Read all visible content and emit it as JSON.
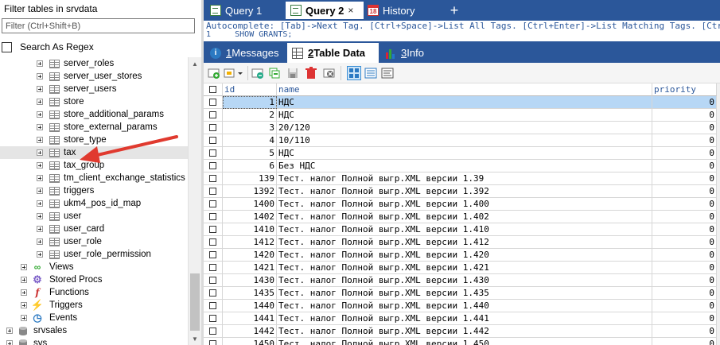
{
  "left_panel": {
    "title": "Filter tables in srvdata",
    "filter_placeholder": "Filter (Ctrl+Shift+B)",
    "regex_label": "Search As Regex",
    "tables": [
      "server_roles",
      "server_user_stores",
      "server_users",
      "store",
      "store_additional_params",
      "store_external_params",
      "store_type",
      "tax",
      "tax_group",
      "tm_client_exchange_statistics",
      "triggers",
      "ukm4_pos_id_map",
      "user",
      "user_card",
      "user_role",
      "user_role_permission"
    ],
    "selected_table": "tax",
    "groups": [
      "Views",
      "Stored Procs",
      "Functions",
      "Triggers",
      "Events"
    ],
    "databases": [
      "srvsales",
      "sys"
    ]
  },
  "query_tabs": {
    "tabs": [
      "Query 1",
      "Query 2",
      "History"
    ],
    "active_index": 1,
    "history_icon_text": "18",
    "close_glyph": "×",
    "add_glyph": "+"
  },
  "editor": {
    "autocomplete_hint": "Autocomplete: [Tab]->Next Tag. [Ctrl+Space]->List All Tags. [Ctrl+Enter]->List Matching Tags. [Ctrl+Shift+Space]->List Matching Tags.",
    "line_number": "1",
    "line_text": "SHOW GRANTS;"
  },
  "result_tabs": {
    "tabs": [
      {
        "num": "1",
        "label": " Messages"
      },
      {
        "num": "2",
        "label": " Table Data"
      },
      {
        "num": "3",
        "label": " Info"
      }
    ],
    "active_index": 1
  },
  "grid": {
    "columns": [
      "id",
      "name",
      "priority"
    ],
    "rows": [
      {
        "id": "1",
        "name": "НДС",
        "priority": "0"
      },
      {
        "id": "2",
        "name": "НДС",
        "priority": "0"
      },
      {
        "id": "3",
        "name": "20/120",
        "priority": "0"
      },
      {
        "id": "4",
        "name": "10/110",
        "priority": "0"
      },
      {
        "id": "5",
        "name": "НДС",
        "priority": "0"
      },
      {
        "id": "6",
        "name": "Без НДС",
        "priority": "0"
      },
      {
        "id": "139",
        "name": "Тест. налог Полной выгр.XML версии 1.39",
        "priority": "0"
      },
      {
        "id": "1392",
        "name": "Тест. налог Полной выгр.XML версии 1.392",
        "priority": "0"
      },
      {
        "id": "1400",
        "name": "Тест. налог Полной выгр.XML версии 1.400",
        "priority": "0"
      },
      {
        "id": "1402",
        "name": "Тест. налог Полной выгр.XML версии 1.402",
        "priority": "0"
      },
      {
        "id": "1410",
        "name": "Тест. налог Полной выгр.XML версии 1.410",
        "priority": "0"
      },
      {
        "id": "1412",
        "name": "Тест. налог Полной выгр.XML версии 1.412",
        "priority": "0"
      },
      {
        "id": "1420",
        "name": "Тест. налог Полной выгр.XML версии 1.420",
        "priority": "0"
      },
      {
        "id": "1421",
        "name": "Тест. налог Полной выгр.XML версии 1.421",
        "priority": "0"
      },
      {
        "id": "1430",
        "name": "Тест. налог Полной выгр.XML версии 1.430",
        "priority": "0"
      },
      {
        "id": "1435",
        "name": "Тест. налог Полной выгр.XML версии 1.435",
        "priority": "0"
      },
      {
        "id": "1440",
        "name": "Тест. налог Полной выгр.XML версии 1.440",
        "priority": "0"
      },
      {
        "id": "1441",
        "name": "Тест. налог Полной выгр.XML версии 1.441",
        "priority": "0"
      },
      {
        "id": "1442",
        "name": "Тест. налог Полной выгр.XML версии 1.442",
        "priority": "0"
      },
      {
        "id": "1450",
        "name": "Тест. налог Полной выгр.XML версии 1.450",
        "priority": "0"
      }
    ],
    "selected_row_index": 0
  },
  "colors": {
    "accent": "#2b579a",
    "selection": "#b7d7f5",
    "arrow": "#e03a2f"
  }
}
